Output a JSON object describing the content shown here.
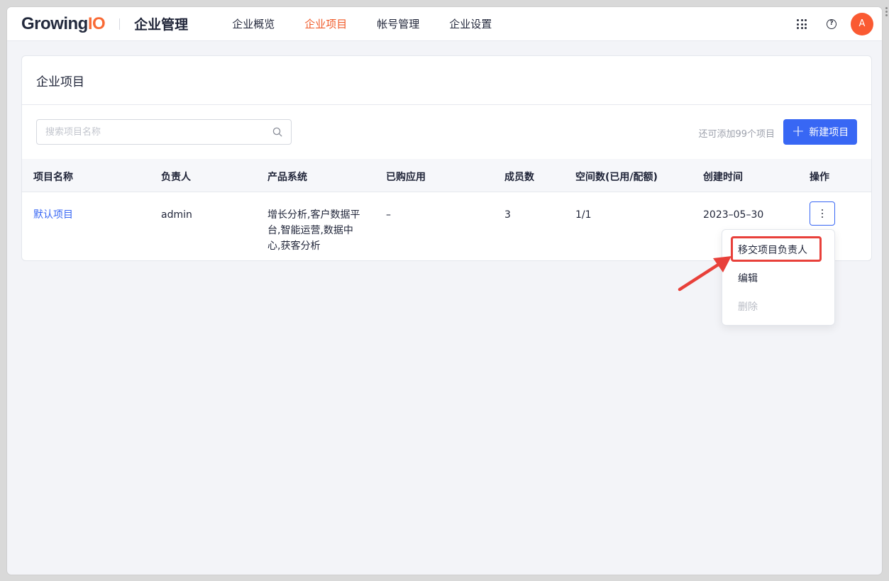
{
  "header": {
    "logo_main": "Growing",
    "logo_io": "IO",
    "app_name": "企业管理",
    "nav": [
      {
        "label": "企业概览",
        "active": false
      },
      {
        "label": "企业项目",
        "active": true
      },
      {
        "label": "帐号管理",
        "active": false
      },
      {
        "label": "企业设置",
        "active": false
      }
    ],
    "apps_icon": "grid-icon",
    "help_label": "?",
    "avatar_label": "A"
  },
  "page": {
    "title": "企业项目",
    "search_placeholder": "搜索项目名称",
    "search_value": "",
    "quota_text": "还可添加99个项目",
    "new_button_icon": "+",
    "new_button_label": "新建项目"
  },
  "table": {
    "columns": [
      "项目名称",
      "负责人",
      "产品系统",
      "已购应用",
      "成员数",
      "空间数(已用/配额)",
      "创建时间",
      "操作"
    ],
    "rows": [
      {
        "name": "默认项目",
        "owner": "admin",
        "products": "增长分析,客户数据平台,智能运营,数据中心,获客分析",
        "apps": "–",
        "members": "3",
        "spaces": "1/1",
        "created": "2023–05–30"
      }
    ]
  },
  "dropdown": {
    "items": [
      {
        "label": "移交项目负责人",
        "disabled": false
      },
      {
        "label": "编辑",
        "disabled": false
      },
      {
        "label": "删除",
        "disabled": true
      }
    ]
  },
  "colors": {
    "brand_orange": "#f96a35",
    "nav_active": "#f05a28",
    "primary_blue": "#3867f4",
    "highlight_red": "#e8403a"
  }
}
